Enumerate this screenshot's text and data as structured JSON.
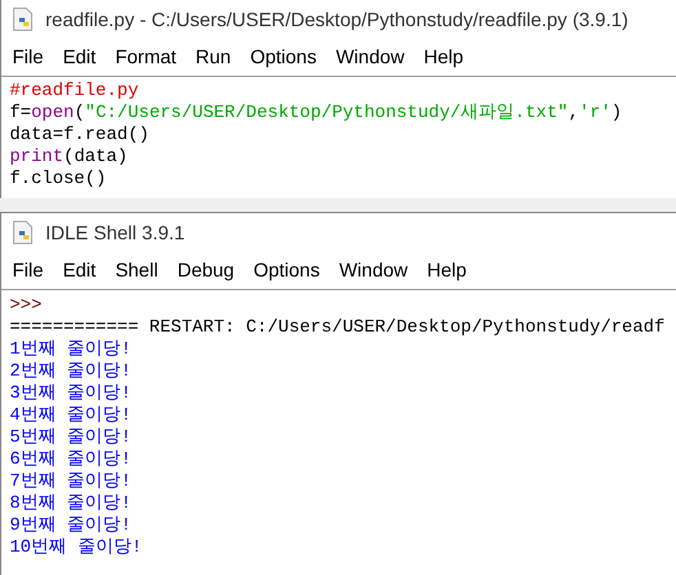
{
  "editor": {
    "title": "readfile.py - C:/Users/USER/Desktop/Pythonstudy/readfile.py (3.9.1)",
    "menu": [
      "File",
      "Edit",
      "Format",
      "Run",
      "Options",
      "Window",
      "Help"
    ],
    "code_lines": [
      {
        "tokens": [
          {
            "kind": "comment",
            "text": "#readfile.py"
          }
        ]
      },
      {
        "tokens": [
          {
            "kind": "plain",
            "text": "f="
          },
          {
            "kind": "builtin",
            "text": "open"
          },
          {
            "kind": "plain",
            "text": "("
          },
          {
            "kind": "string",
            "text": "\"C:/Users/USER/Desktop/Pythonstudy/새파일.txt\""
          },
          {
            "kind": "plain",
            "text": ","
          },
          {
            "kind": "string",
            "text": "'r'"
          },
          {
            "kind": "plain",
            "text": ")"
          }
        ]
      },
      {
        "tokens": [
          {
            "kind": "plain",
            "text": "data=f.read()"
          }
        ]
      },
      {
        "tokens": [
          {
            "kind": "builtin",
            "text": "print"
          },
          {
            "kind": "plain",
            "text": "(data)"
          }
        ]
      },
      {
        "tokens": [
          {
            "kind": "plain",
            "text": "f.close()"
          }
        ]
      }
    ]
  },
  "shell": {
    "title": "IDLE Shell 3.9.1",
    "menu": [
      "File",
      "Edit",
      "Shell",
      "Debug",
      "Options",
      "Window",
      "Help"
    ],
    "output_lines": [
      {
        "kind": "prompt",
        "text": ">>>"
      },
      {
        "kind": "restart",
        "text": "============ RESTART: C:/Users/USER/Desktop/Pythonstudy/readf"
      },
      {
        "kind": "stdout",
        "text": "1번째 줄이당!"
      },
      {
        "kind": "stdout",
        "text": "2번째 줄이당!"
      },
      {
        "kind": "stdout",
        "text": "3번째 줄이당!"
      },
      {
        "kind": "stdout",
        "text": "4번째 줄이당!"
      },
      {
        "kind": "stdout",
        "text": "5번째 줄이당!"
      },
      {
        "kind": "stdout",
        "text": "6번째 줄이당!"
      },
      {
        "kind": "stdout",
        "text": "7번째 줄이당!"
      },
      {
        "kind": "stdout",
        "text": "8번째 줄이당!"
      },
      {
        "kind": "stdout",
        "text": "9번째 줄이당!"
      },
      {
        "kind": "stdout",
        "text": "10번째 줄이당!"
      }
    ]
  }
}
